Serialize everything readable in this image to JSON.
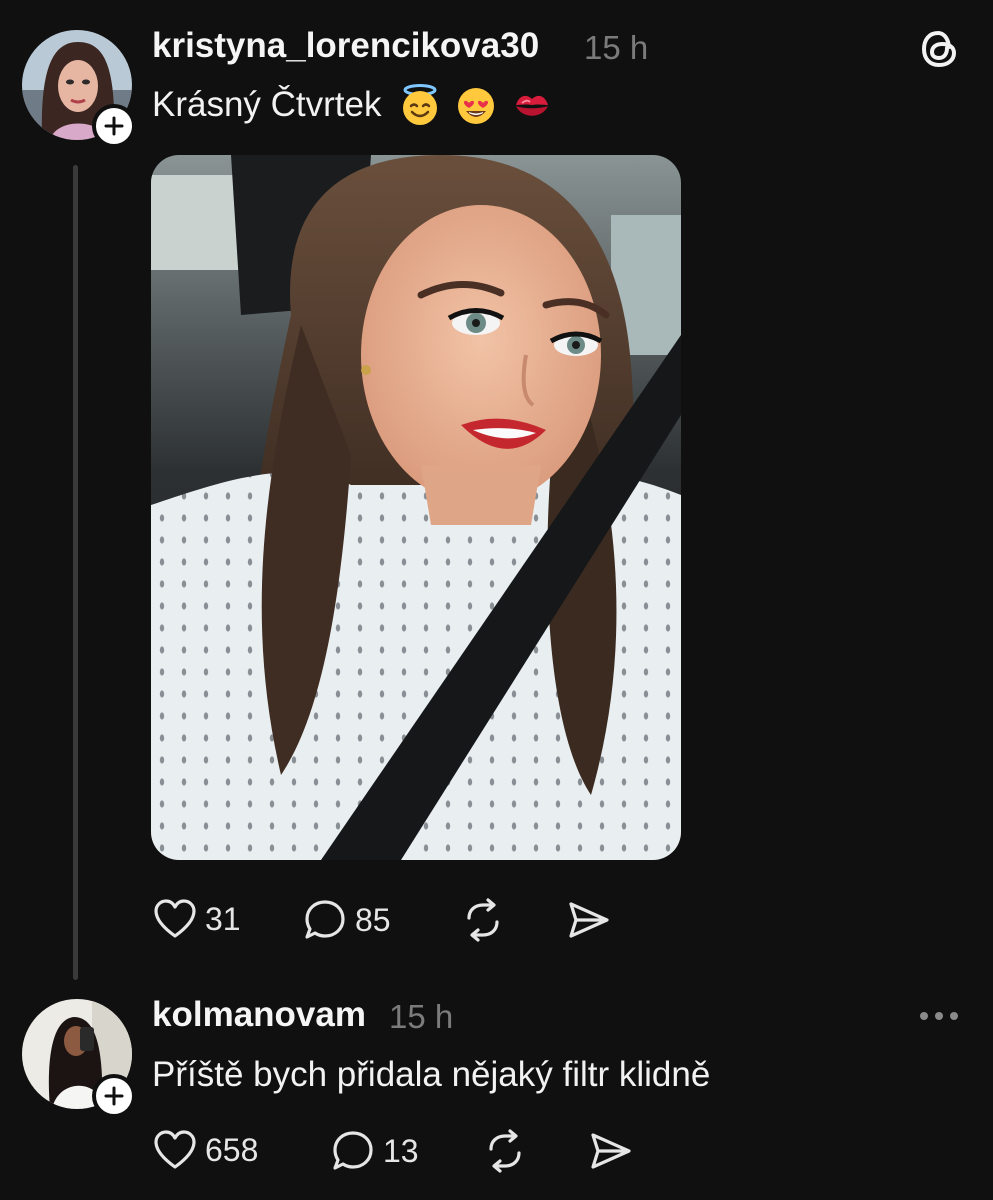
{
  "post": {
    "username": "kristyna_lorencikova30",
    "timestamp": "15 h",
    "text": "Krásný Čtvrtek",
    "emojis": [
      "smiling-face-with-halo",
      "smiling-face-with-heart-eyes",
      "kiss-mark"
    ],
    "likes": "31",
    "replies": "85"
  },
  "reply": {
    "username": "kolmanovam",
    "timestamp": "15 h",
    "text": "Příště bych přidala nějaký filtr klidně",
    "likes": "658",
    "replies": "13"
  },
  "icons": {
    "app_logo": "threads-logo-icon",
    "follow": "plus-icon",
    "like": "heart-icon",
    "reply": "speech-bubble-icon",
    "repost": "repost-icon",
    "share": "send-icon",
    "more": "more-horizontal-icon"
  },
  "colors": {
    "background": "#101010",
    "primary_text": "#f3f3f3",
    "secondary_text": "#7b7b7b",
    "thread_line": "#3a3a3a"
  }
}
